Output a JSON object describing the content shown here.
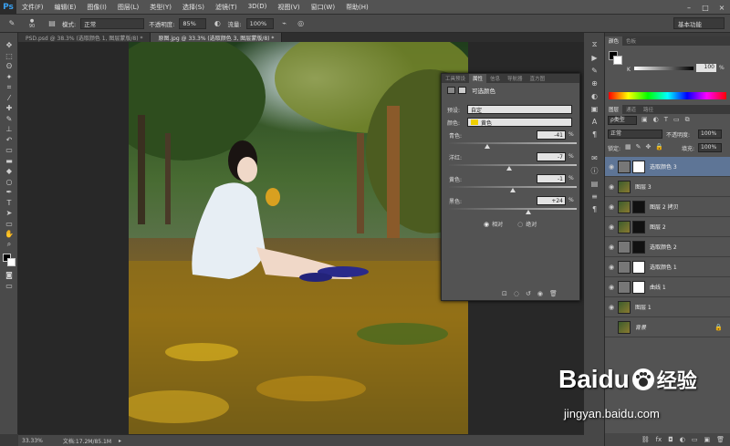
{
  "app": {
    "logo": "Ps"
  },
  "menu": [
    "文件(F)",
    "编辑(E)",
    "图像(I)",
    "图层(L)",
    "类型(Y)",
    "选择(S)",
    "滤镜(T)",
    "3D(D)",
    "视图(V)",
    "窗口(W)",
    "帮助(H)"
  ],
  "options": {
    "brush_size": "90",
    "mode_label": "模式:",
    "mode_value": "正常",
    "opacity_label": "不透明度:",
    "opacity_value": "85%",
    "flow_label": "流量:",
    "flow_value": "100%",
    "workspace": "基本功能"
  },
  "tabs": [
    {
      "label": "PSD.psd @ 38.3% (选取颜色 1, 图层蒙版/8) *"
    },
    {
      "label": "原图.jpg @ 33.3% (选取颜色 3, 图层蒙版/8) *"
    }
  ],
  "status": {
    "zoom": "33.33%",
    "doc": "文档:17.2M/85.1M"
  },
  "properties": {
    "tabs": [
      "工具预设",
      "属性",
      "信息",
      "导航器",
      "直方图"
    ],
    "title": "可选颜色",
    "preset_label": "预设:",
    "preset_value": "自定",
    "color_label": "颜色:",
    "color_value": "黄色",
    "sliders": [
      {
        "label": "青色:",
        "value": "-41",
        "unit": "%",
        "pos": 0.3
      },
      {
        "label": "洋红:",
        "value": "-7",
        "unit": "%",
        "pos": 0.47
      },
      {
        "label": "黄色:",
        "value": "-1",
        "unit": "%",
        "pos": 0.5
      },
      {
        "label": "黑色:",
        "value": "+24",
        "unit": "%",
        "pos": 0.62
      }
    ],
    "radio_relative": "相对",
    "radio_absolute": "绝对"
  },
  "color_panel": {
    "tabs": [
      "颜色",
      "色板"
    ],
    "k_label": "K",
    "k_value": "100",
    "k_unit": "%"
  },
  "layers_panel": {
    "tabs": [
      "图层",
      "通道",
      "路径"
    ],
    "filter": "ρ类型",
    "blend": "正常",
    "opacity_label": "不透明度:",
    "opacity": "100%",
    "lock_label": "锁定:",
    "fill_label": "填充:",
    "fill": "100%",
    "layers": [
      {
        "name": "选取颜色 3",
        "type": "adj",
        "selected": true
      },
      {
        "name": "图层 3",
        "type": "img"
      },
      {
        "name": "图层 2 拷贝",
        "type": "img-mask"
      },
      {
        "name": "图层 2",
        "type": "img-mask"
      },
      {
        "name": "选取颜色 2",
        "type": "adj-dark"
      },
      {
        "name": "选取颜色 1",
        "type": "adj"
      },
      {
        "name": "曲线 1",
        "type": "adj"
      },
      {
        "name": "图层 1",
        "type": "img"
      },
      {
        "name": "背景",
        "type": "bg"
      }
    ]
  },
  "watermark": {
    "brand": "Baidu",
    "cn": "经验",
    "url": "jingyan.baidu.com"
  }
}
